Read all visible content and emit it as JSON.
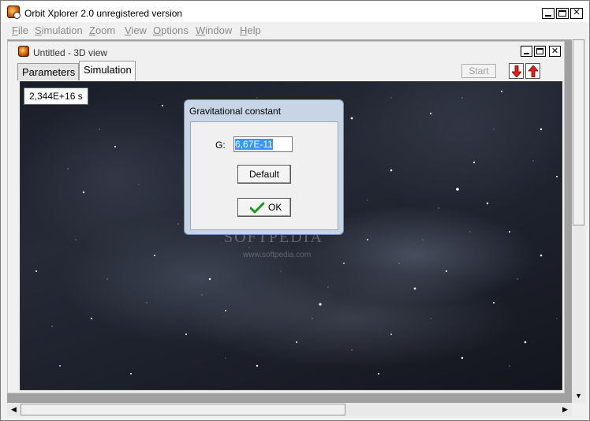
{
  "app": {
    "title": "Orbit Xplorer 2.0 unregistered version",
    "window_buttons": {
      "minimize": "_",
      "maximize": "□",
      "close": "✕"
    }
  },
  "menu": {
    "items": [
      {
        "label": "File",
        "accel": "F",
        "rest": "ile"
      },
      {
        "label": "Simulation",
        "accel": "S",
        "rest": "imulation"
      },
      {
        "label": "Zoom",
        "accel": "Z",
        "rest": "oom"
      },
      {
        "label": "View",
        "accel": "V",
        "rest": "iew"
      },
      {
        "label": "Options",
        "accel": "O",
        "rest": "ptions"
      },
      {
        "label": "Window",
        "accel": "W",
        "rest": "indow"
      },
      {
        "label": "Help",
        "accel": "H",
        "rest": "elp"
      }
    ]
  },
  "child": {
    "title": "Untitled - 3D view",
    "tabs": [
      {
        "label": "Parameters",
        "active": false
      },
      {
        "label": "Simulation",
        "active": true
      }
    ],
    "start_label": "Start",
    "time_readout": "2,344E+16 s"
  },
  "dialog": {
    "title": "Gravitational constant",
    "g_label": "G:",
    "g_value": "6,67E-11",
    "default_label": "Default",
    "ok_label": "OK"
  },
  "watermark": {
    "text": "SOFTPEDIA",
    "url": "www.softpedia.com"
  },
  "colors": {
    "arrow_red": "#e8201a",
    "selection_blue": "#3399ff",
    "dialog_frame": "#c7d5e6",
    "space_dark": "#1e222d"
  },
  "icons": {
    "app": "orbit-planet-icon",
    "down": "arrow-down-icon",
    "up": "arrow-up-icon",
    "ok": "checkmark-icon"
  }
}
